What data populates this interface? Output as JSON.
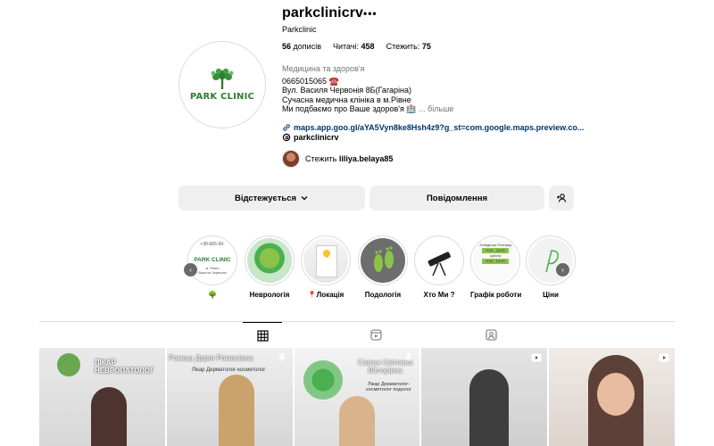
{
  "profile": {
    "username": "parkclinicrv",
    "more_icon": "•••",
    "full_name": "Parkclinic",
    "avatar_logo_text": "PARK CLINIC",
    "stats": {
      "posts_count": "56",
      "posts_label": "дописів",
      "followers_label": "Читачі:",
      "followers_count": "458",
      "following_label": "Стежить:",
      "following_count": "75"
    },
    "bio": {
      "category": "Медицина та здоров'я",
      "phone": "0665015065 ☎️",
      "address": "Вул. Василя Червонія 8Б(Гагаріна)",
      "line3": "Сучасна медична клініка в м.Рівне",
      "line4": "Ми подбаємо про Ваше здоров'я 🏥",
      "more": "... більше"
    },
    "link": "maps.app.goo.gl/aYA5Vyn8ke8Hsh4z9?g_st=com.google.maps.preview.co...",
    "threads_handle": "parkclinicrv",
    "followed_by_prefix": "Стежить",
    "followed_by_user": "liliya.belaya85"
  },
  "buttons": {
    "following": "Відстежується",
    "message": "Повідомлення",
    "suggest_icon": "add-person-icon"
  },
  "highlights": [
    {
      "label": "🌳",
      "icon": "tree-icon"
    },
    {
      "label": "Неврологія"
    },
    {
      "label": "📍Локація"
    },
    {
      "label": "Подологія"
    },
    {
      "label": "Хто Ми ?"
    },
    {
      "label": "Графік роботи"
    },
    {
      "label": "Ціни"
    }
  ],
  "highlight_card_texts": {
    "hl1_phone": "+38-665-50-",
    "hl1_address": "м. Рівне\nВасиля Червонія",
    "hl6_line1": "Понеділок-П'ятниця",
    "hl6_time1": "9:00 - 18:00",
    "hl6_line2": "субота",
    "hl6_time2": "9:00 - 15:00"
  },
  "tabs": [
    {
      "name": "posts",
      "icon": "grid-icon",
      "active": true
    },
    {
      "name": "reels",
      "icon": "reels-icon",
      "active": false
    },
    {
      "name": "tagged",
      "icon": "tagged-icon",
      "active": false
    }
  ],
  "posts": [
    {
      "text": "ЛІКАР\nНЕВРОПАТОЛОГ",
      "badge": "none"
    },
    {
      "text": "Ромаш Дарія Романівна",
      "subtitle": "Лікар Дерматолог-косметолог",
      "badge": "pin-icon"
    },
    {
      "text": "Савчук Світлана Вікторівна",
      "subtitle": "Лікар Дерматолог-косметолог подолог",
      "badge": "pin-icon"
    },
    {
      "text": "",
      "badge": "reel-icon"
    },
    {
      "text": "",
      "badge": "reel-icon"
    }
  ],
  "colors": {
    "brand_green": "#2e7d32",
    "link_blue": "#00376b",
    "button_bg": "#efefef",
    "secondary_text": "#737373"
  }
}
